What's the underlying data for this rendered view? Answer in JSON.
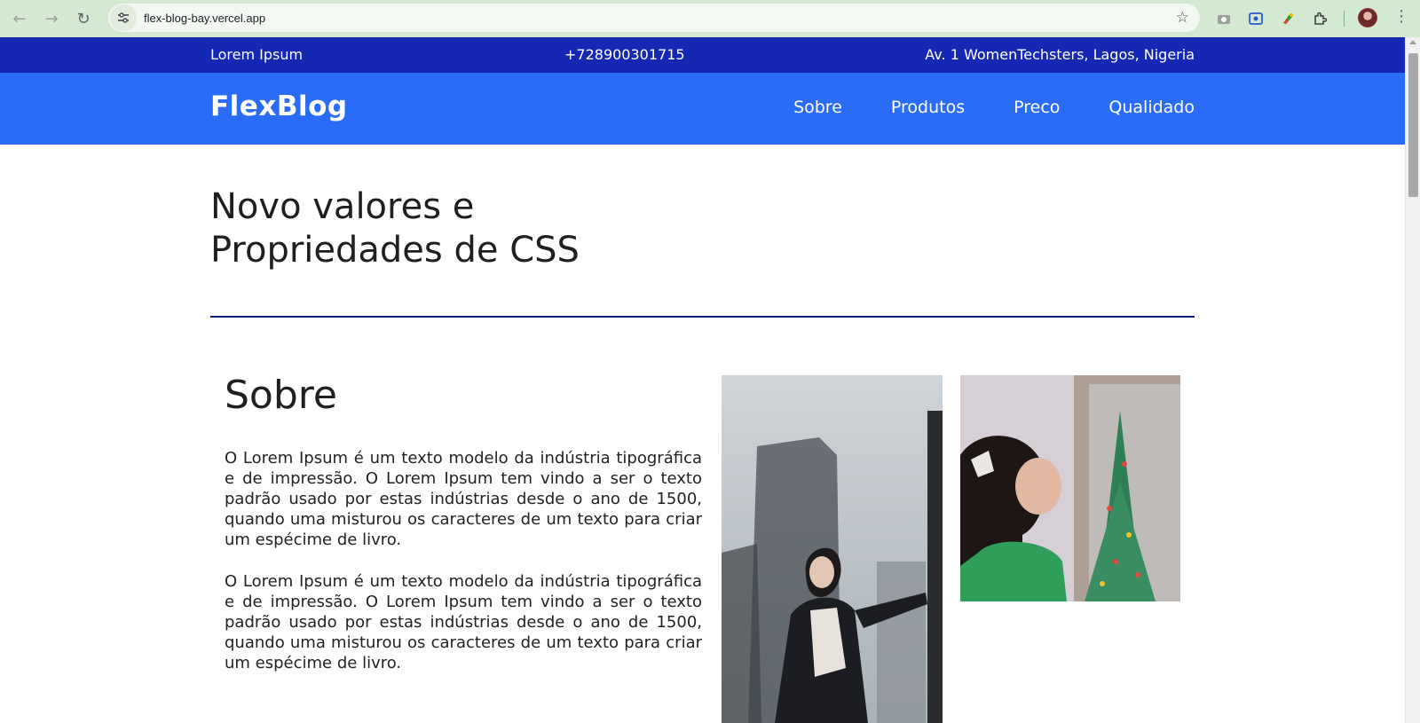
{
  "browser": {
    "url": "flex-blog-bay.vercel.app"
  },
  "topbar": {
    "left": "Lorem Ipsum",
    "phone": "+728900301715",
    "address": "Av. 1 WomenTechsters, Lagos, Nigeria"
  },
  "header": {
    "logo": "FlexBlog",
    "nav": [
      "Sobre",
      "Produtos",
      "Preco",
      "Qualidado"
    ]
  },
  "hero": {
    "title_line1": "Novo valores e",
    "title_line2": "Propriedades de CSS"
  },
  "about": {
    "title": "Sobre",
    "paragraphs": [
      "O Lorem Ipsum é um texto modelo da indústria tipográfica e de impressão. O Lorem Ipsum tem vindo a ser o texto padrão usado por estas indústrias desde o ano de 1500, quando uma misturou os caracteres de um texto para criar um espécime de livro.",
      "O Lorem Ipsum é um texto modelo da indústria tipográfica e de impressão. O Lorem Ipsum tem vindo a ser o texto padrão usado por estas indústrias desde o ano de 1500, quando uma misturou os caracteres de um texto para criar um espécime de livro."
    ]
  },
  "colors": {
    "topbar_bg": "#1428b4",
    "header_bg": "#2b6cf6",
    "divider": "#0c1b8a"
  }
}
